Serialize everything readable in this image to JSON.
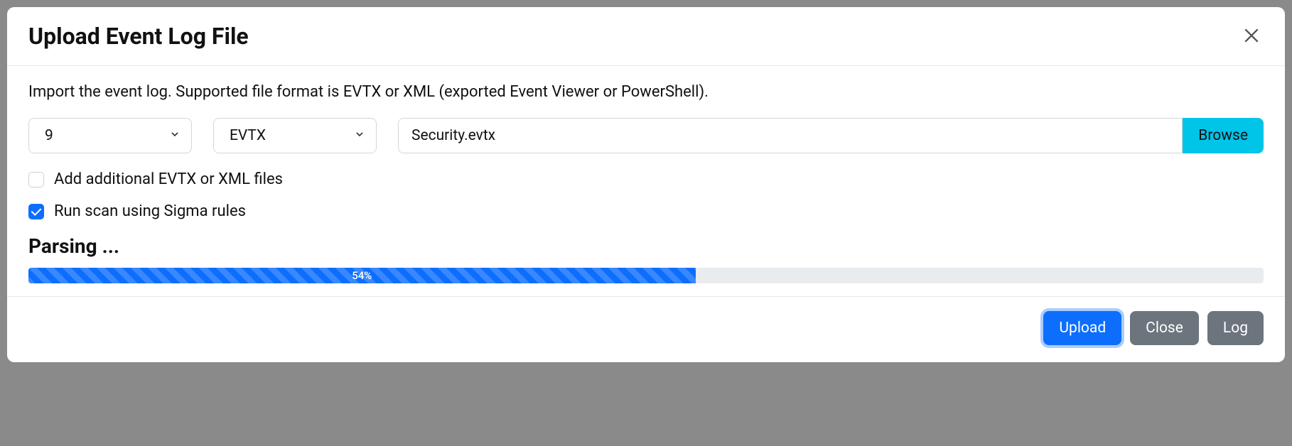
{
  "modal": {
    "title": "Upload Event Log File",
    "description": "Import the event log. Supported file format is EVTX or XML (exported Event Viewer or PowerShell).",
    "number_select": "9",
    "format_select": "EVTX",
    "file_path": "Security.evtx",
    "browse_label": "Browse",
    "checkbox_additional": {
      "label": "Add additional EVTX or XML files",
      "checked": false
    },
    "checkbox_sigma": {
      "label": "Run scan using Sigma rules",
      "checked": true
    },
    "status_label": "Parsing ...",
    "progress_percent": 54,
    "progress_text": "54%"
  },
  "footer": {
    "upload_label": "Upload",
    "close_label": "Close",
    "log_label": "Log"
  }
}
